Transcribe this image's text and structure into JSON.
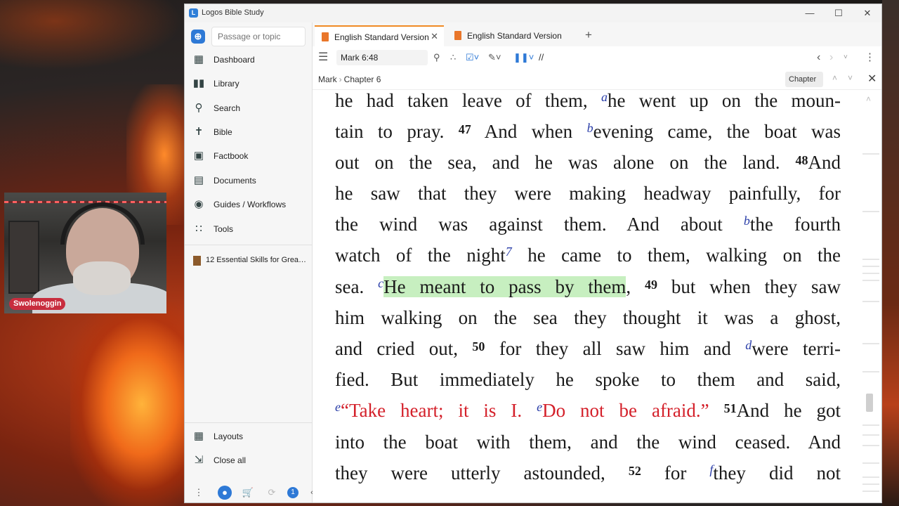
{
  "window": {
    "title": "Logos Bible Study"
  },
  "sidebar": {
    "search_placeholder": "Passage or topic",
    "items": [
      {
        "label": "Dashboard",
        "icon": "dashboard-icon"
      },
      {
        "label": "Library",
        "icon": "library-icon"
      },
      {
        "label": "Search",
        "icon": "search-icon"
      },
      {
        "label": "Bible",
        "icon": "bible-icon"
      },
      {
        "label": "Factbook",
        "icon": "factbook-icon"
      },
      {
        "label": "Documents",
        "icon": "documents-icon"
      },
      {
        "label": "Guides / Workflows",
        "icon": "guides-icon"
      },
      {
        "label": "Tools",
        "icon": "tools-icon"
      }
    ],
    "recent_book": "12 Essential Skills for Grea…",
    "bottom_items": [
      {
        "label": "Layouts",
        "icon": "layouts-icon"
      },
      {
        "label": "Close all",
        "icon": "close-all-icon"
      }
    ],
    "notification_count": "1"
  },
  "tabs": [
    {
      "label": "English Standard Version",
      "active": true
    },
    {
      "label": "English Standard Version",
      "active": false
    }
  ],
  "toolbar": {
    "reference": "Mark 6:48",
    "parallel": "//"
  },
  "breadcrumb": {
    "book": "Mark",
    "chapter": "Chapter 6"
  },
  "chapter_select": "Chapter",
  "webcam": {
    "name": "Swolenoggin"
  },
  "colors": {
    "accent": "#f08a24",
    "words_of_christ": "#d4202a",
    "highlight": "#c7efc0",
    "footnote": "#2a3ea8"
  },
  "text": {
    "l1": "he had taken leave of them,",
    "l1_fn": "a",
    "l1b": "he went up on the moun-",
    "l2a": "tain to pray.",
    "v47": "47",
    "l2b": "And when",
    "l2_fn": "b",
    "l2c": "evening came, the boat was",
    "l3a": "out on the sea, and he was alone on the land.",
    "v48": "48",
    "l3b": "And",
    "l4": "he saw that they were making headway painfully, for",
    "l5a": "the wind was against them. And about",
    "l5_fn": "b",
    "l5b": "the fourth",
    "l6a": "watch of the night",
    "l6_fn": "7",
    "l6b": "he came to them, walking on the",
    "l7a": "sea.",
    "l7_fn": "c",
    "l7_hl": "He meant to pass by them",
    "l7b": ",",
    "v49": "49",
    "l7c": "but when they saw",
    "l8": "him walking on the sea they thought it was a ghost,",
    "l9a": "and cried out,",
    "v50": "50",
    "l9b": "for they all saw him and",
    "l9_fn": "d",
    "l9c": "were terri-",
    "l10": "fied. But immediately he spoke to them and said,",
    "l11_fn1": "e",
    "l11_red1": "“Take heart; it is I.",
    "l11_fn2": "e",
    "l11_red2": "Do not be afraid.”",
    "v51": "51",
    "l11b": "And he got",
    "l12": "into the boat with them, and the wind ceased. And",
    "l13a": "they were utterly astounded,",
    "v52": "52",
    "l13b": "for",
    "l13_fn": "f",
    "l13c": "they did not"
  }
}
